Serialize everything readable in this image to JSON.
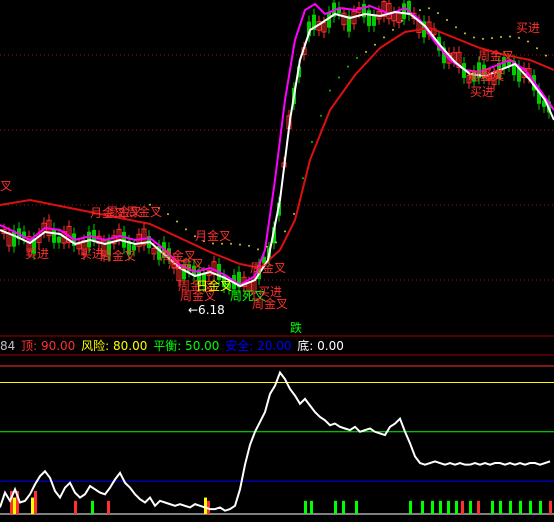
{
  "chart_data": [
    {
      "type": "line",
      "panel": "price",
      "series": [
        {
          "id": "candles_up",
          "color": "#ff3030"
        },
        {
          "id": "candles_down",
          "color": "#00cc00"
        },
        {
          "id": "ma_white",
          "color": "#ffffff"
        },
        {
          "id": "ma_magenta",
          "color": "#ff00ff"
        },
        {
          "id": "ma_red",
          "color": "#dd1010"
        },
        {
          "id": "sar_dots",
          "color": "#00ff00"
        }
      ],
      "grid": "dotted red horizontal",
      "annotations": [
        {
          "text": "叉",
          "color": "#ff3030"
        },
        {
          "text": "月金叉",
          "color": "#ff3030"
        },
        {
          "text": "周金叉",
          "color": "#ff3030"
        },
        {
          "text": "周金叉",
          "color": "#ff3030"
        },
        {
          "text": "买进",
          "color": "#ff3030"
        },
        {
          "text": "买进",
          "color": "#ff3030"
        },
        {
          "text": "周金叉",
          "color": "#ff3030"
        },
        {
          "text": "月金叉",
          "color": "#ff3030"
        },
        {
          "text": "周金叉",
          "color": "#ff3030"
        },
        {
          "text": "周金叉",
          "color": "#ff3030"
        },
        {
          "text": "周金叉",
          "color": "#ff3030"
        },
        {
          "text": "周金叉",
          "color": "#ff3030"
        },
        {
          "text": "日金叉",
          "color": "#ffff00"
        },
        {
          "text": "周死叉",
          "color": "#00ff00"
        },
        {
          "text": "买进",
          "color": "#ff3030"
        },
        {
          "text": "周金叉",
          "color": "#ff3030"
        },
        {
          "text": "周金叉",
          "color": "#ff3030"
        },
        {
          "text": "周金叉",
          "color": "#ff3030"
        },
        {
          "text": "买进",
          "color": "#ff3030"
        },
        {
          "text": "买进",
          "color": "#ff3030"
        },
        {
          "text": "周金叉",
          "color": "#ff3030"
        },
        {
          "text": "买进",
          "color": "#ff3030"
        },
        {
          "text": "←6.18",
          "color": "#ffffff"
        },
        {
          "text": "跌",
          "color": "#00ff00"
        }
      ]
    },
    {
      "type": "line",
      "panel": "indicator",
      "legend": [
        {
          "label": "84",
          "color": "#c0c0c0"
        },
        {
          "label": "顶: 90.00",
          "color": "#ff3030"
        },
        {
          "label": "风险: 80.00",
          "color": "#ffff00"
        },
        {
          "label": "平衡: 50.00",
          "color": "#00ff00"
        },
        {
          "label": "安全: 20.00",
          "color": "#0000ff"
        },
        {
          "label": "底: 0.00",
          "color": "#ffffff"
        }
      ],
      "levels": [
        {
          "name": "顶",
          "value": 90,
          "color": "#ff3030"
        },
        {
          "name": "风险",
          "value": 80,
          "color": "#ffff00"
        },
        {
          "name": "平衡",
          "value": 50,
          "color": "#00ff00"
        },
        {
          "name": "安全",
          "value": 20,
          "color": "#0000ff"
        },
        {
          "name": "底",
          "value": 0,
          "color": "#ffffff"
        }
      ],
      "ylim": [
        0,
        90
      ],
      "x": [
        0,
        5,
        10,
        15,
        20,
        25,
        30,
        35,
        40,
        45,
        50,
        55,
        60,
        65,
        70,
        75,
        80,
        85,
        90,
        95,
        100,
        105,
        110,
        115,
        120,
        125,
        130,
        135,
        140,
        145,
        150,
        155,
        160,
        165,
        170,
        175,
        180,
        185,
        190,
        195,
        200,
        205,
        210,
        215,
        220,
        225,
        230,
        235,
        240,
        245,
        250,
        255,
        260,
        265,
        270,
        275,
        280,
        285,
        290,
        295,
        300,
        305,
        310,
        315,
        320,
        325,
        330,
        335,
        340,
        345,
        350,
        355,
        360,
        365,
        370,
        375,
        380,
        385,
        390,
        395,
        400,
        405,
        410,
        415,
        420,
        425,
        430,
        435,
        440,
        445,
        450,
        455,
        460,
        465,
        470,
        475,
        480,
        485,
        490,
        495,
        500,
        505,
        510,
        515,
        520,
        525,
        530,
        535,
        540,
        545,
        550
      ],
      "values": [
        4,
        13,
        8,
        15,
        7,
        8,
        12,
        18,
        23,
        26,
        22,
        14,
        10,
        16,
        19,
        13,
        10,
        12,
        17,
        15,
        13,
        12,
        16,
        21,
        25,
        19,
        16,
        12,
        9,
        7,
        10,
        5,
        8,
        7,
        6,
        5,
        6,
        5,
        4,
        6,
        5,
        4,
        3,
        3,
        4,
        2,
        3,
        5,
        15,
        30,
        42,
        50,
        56,
        62,
        73,
        78,
        86,
        82,
        76,
        72,
        67,
        70,
        66,
        62,
        59,
        57,
        54,
        55,
        53,
        52,
        51,
        53,
        50,
        51,
        52,
        50,
        49,
        48,
        53,
        55,
        58,
        50,
        43,
        35,
        31,
        30,
        31,
        32,
        31,
        30,
        31,
        30,
        31,
        30,
        30,
        31,
        30,
        31,
        30,
        31,
        31,
        30,
        31,
        30,
        31,
        30,
        31,
        31,
        30,
        31,
        32
      ],
      "signal_bars": [
        {
          "x": 11,
          "level": 14,
          "color": "#ff3030"
        },
        {
          "x": 14,
          "level": 10,
          "color": "#ffff00"
        },
        {
          "x": 17,
          "level": 14,
          "color": "#ff3030"
        },
        {
          "x": 32,
          "level": 10,
          "color": "#ffff00"
        },
        {
          "x": 35,
          "level": 14,
          "color": "#ff3030"
        },
        {
          "x": 75,
          "level": 8,
          "color": "#ff3030"
        },
        {
          "x": 92,
          "level": 8,
          "color": "#00ff00"
        },
        {
          "x": 108,
          "level": 8,
          "color": "#ff3030"
        },
        {
          "x": 205,
          "level": 10,
          "color": "#ffff00"
        },
        {
          "x": 208,
          "level": 8,
          "color": "#ff3030"
        },
        {
          "x": 305,
          "level": 8,
          "color": "#00ff00"
        },
        {
          "x": 311,
          "level": 8,
          "color": "#00ff00"
        },
        {
          "x": 335,
          "level": 8,
          "color": "#00ff00"
        },
        {
          "x": 343,
          "level": 8,
          "color": "#00ff00"
        },
        {
          "x": 356,
          "level": 8,
          "color": "#00ff00"
        },
        {
          "x": 410,
          "level": 8,
          "color": "#00ff00"
        },
        {
          "x": 422,
          "level": 8,
          "color": "#00ff00"
        },
        {
          "x": 432,
          "level": 8,
          "color": "#00ff00"
        },
        {
          "x": 440,
          "level": 8,
          "color": "#00ff00"
        },
        {
          "x": 448,
          "level": 8,
          "color": "#00ff00"
        },
        {
          "x": 456,
          "level": 8,
          "color": "#00ff00"
        },
        {
          "x": 462,
          "level": 8,
          "color": "#ff3030"
        },
        {
          "x": 470,
          "level": 8,
          "color": "#00ff00"
        },
        {
          "x": 478,
          "level": 8,
          "color": "#ff3030"
        },
        {
          "x": 492,
          "level": 8,
          "color": "#00ff00"
        },
        {
          "x": 500,
          "level": 8,
          "color": "#00ff00"
        },
        {
          "x": 510,
          "level": 8,
          "color": "#00ff00"
        },
        {
          "x": 520,
          "level": 8,
          "color": "#00ff00"
        },
        {
          "x": 530,
          "level": 8,
          "color": "#00ff00"
        },
        {
          "x": 540,
          "level": 8,
          "color": "#00ff00"
        },
        {
          "x": 550,
          "level": 8,
          "color": "#ff3030"
        }
      ]
    }
  ]
}
